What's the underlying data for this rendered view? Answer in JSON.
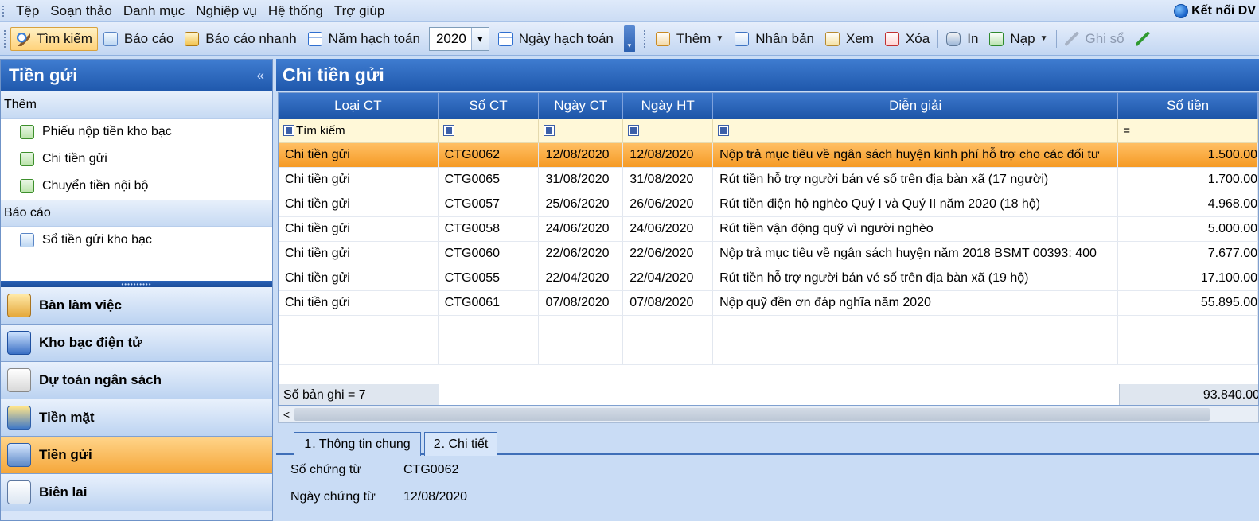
{
  "menu": {
    "items": [
      "Tệp",
      "Soạn thảo",
      "Danh mục",
      "Nghiệp vụ",
      "Hệ thống",
      "Trợ giúp"
    ],
    "connect": "Kết nối DV"
  },
  "toolbar": {
    "search": "Tìm kiếm",
    "report": "Báo cáo",
    "quick_report": "Báo cáo nhanh",
    "fiscal_year_label": "Năm hạch toán",
    "fiscal_year": "2020",
    "posting_date": "Ngày hạch toán",
    "add": "Thêm",
    "duplicate": "Nhân bản",
    "view": "Xem",
    "delete": "Xóa",
    "print": "In",
    "load": "Nạp",
    "post": "Ghi sổ"
  },
  "sidebar": {
    "title": "Tiền gửi",
    "collapse": "«",
    "section_add": "Thêm",
    "add_items": [
      "Phiếu nộp tiền kho bạc",
      "Chi tiền gửi",
      "Chuyển tiền nội bộ"
    ],
    "section_report": "Báo cáo",
    "report_items": [
      "Sổ tiền gửi kho bạc"
    ],
    "splitter": "••••••••••",
    "nav": [
      "Bàn làm việc",
      "Kho bạc điện tử",
      "Dự toán ngân sách",
      "Tiền mặt",
      "Tiền gửi",
      "Biên lai"
    ]
  },
  "main": {
    "title": "Chi tiền gửi",
    "columns": [
      "Loại CT",
      "Số CT",
      "Ngày CT",
      "Ngày HT",
      "Diễn giải",
      "Số tiền"
    ],
    "filter_label": "Tìm kiếm",
    "filter_eq": "=",
    "rows": [
      [
        "Chi tiền gửi",
        "CTG0062",
        "12/08/2020",
        "12/08/2020",
        "Nộp trả mục tiêu về ngân sách huyện kinh phí hỗ trợ cho các đối tư",
        "1.500.00"
      ],
      [
        "Chi tiền gửi",
        "CTG0065",
        "31/08/2020",
        "31/08/2020",
        "Rút tiền hỗ trợ người bán vé số trên địa bàn xã (17 người)",
        "1.700.00"
      ],
      [
        "Chi tiền gửi",
        "CTG0057",
        "25/06/2020",
        "26/06/2020",
        "Rút tiền điện hộ nghèo Quý I và Quý II năm 2020 (18 hộ)",
        "4.968.00"
      ],
      [
        "Chi tiền gửi",
        "CTG0058",
        "24/06/2020",
        "24/06/2020",
        "Rút  tiền vận động quỹ vì người nghèo",
        "5.000.00"
      ],
      [
        "Chi tiền gửi",
        "CTG0060",
        "22/06/2020",
        "22/06/2020",
        "Nộp trả mục tiêu về ngân sách huyện năm 2018 BSMT 00393: 400",
        "7.677.00"
      ],
      [
        "Chi tiền gửi",
        "CTG0055",
        "22/04/2020",
        "22/04/2020",
        "Rút tiền hỗ trợ người bán vé số trên địa bàn xã (19 hộ)",
        "17.100.00"
      ],
      [
        "Chi tiền gửi",
        "CTG0061",
        "07/08/2020",
        "07/08/2020",
        "Nộp quỹ đền ơn đáp nghĩa năm 2020",
        "55.895.00"
      ]
    ],
    "record_count": "Số bản ghi = 7",
    "total": "93.840.00",
    "scroll_left": "<"
  },
  "tabs": {
    "tab1_num": "1",
    "tab1_label": ". Thông tin chung",
    "tab2_num": "2",
    "tab2_label": ". Chi tiết"
  },
  "detail": {
    "doc_no_label": "Số chứng từ",
    "doc_no": "CTG0062",
    "doc_date_label": "Ngày chứng từ",
    "doc_date": "12/08/2020"
  }
}
